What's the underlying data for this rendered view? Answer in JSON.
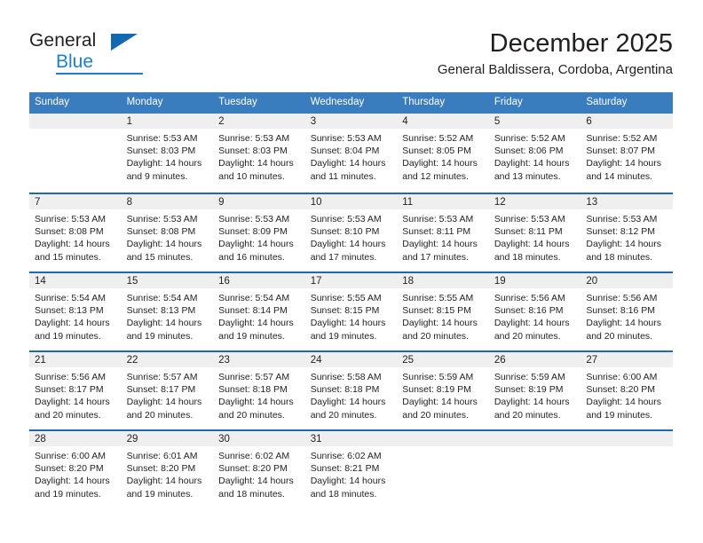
{
  "brand": {
    "name_top": "General",
    "name_bottom": "Blue",
    "accent_color": "#1b7fd4",
    "triangle_color": "#1268b3"
  },
  "header": {
    "title": "December 2025",
    "subtitle": "General Baldissera, Cordoba, Argentina"
  },
  "theme": {
    "header_blue": "#3a7dbf",
    "row_divider_blue": "#1f69b3",
    "daynum_bg": "#efefef",
    "text": "#231f20"
  },
  "weekday_headers": [
    "Sunday",
    "Monday",
    "Tuesday",
    "Wednesday",
    "Thursday",
    "Friday",
    "Saturday"
  ],
  "weeks": [
    [
      {
        "day": "",
        "empty": true,
        "sunrise": "",
        "sunset": "",
        "daylight_1": "",
        "daylight_2": ""
      },
      {
        "day": "1",
        "empty": false,
        "sunrise": "Sunrise: 5:53 AM",
        "sunset": "Sunset: 8:03 PM",
        "daylight_1": "Daylight: 14 hours",
        "daylight_2": "and 9 minutes."
      },
      {
        "day": "2",
        "empty": false,
        "sunrise": "Sunrise: 5:53 AM",
        "sunset": "Sunset: 8:03 PM",
        "daylight_1": "Daylight: 14 hours",
        "daylight_2": "and 10 minutes."
      },
      {
        "day": "3",
        "empty": false,
        "sunrise": "Sunrise: 5:53 AM",
        "sunset": "Sunset: 8:04 PM",
        "daylight_1": "Daylight: 14 hours",
        "daylight_2": "and 11 minutes."
      },
      {
        "day": "4",
        "empty": false,
        "sunrise": "Sunrise: 5:52 AM",
        "sunset": "Sunset: 8:05 PM",
        "daylight_1": "Daylight: 14 hours",
        "daylight_2": "and 12 minutes."
      },
      {
        "day": "5",
        "empty": false,
        "sunrise": "Sunrise: 5:52 AM",
        "sunset": "Sunset: 8:06 PM",
        "daylight_1": "Daylight: 14 hours",
        "daylight_2": "and 13 minutes."
      },
      {
        "day": "6",
        "empty": false,
        "sunrise": "Sunrise: 5:52 AM",
        "sunset": "Sunset: 8:07 PM",
        "daylight_1": "Daylight: 14 hours",
        "daylight_2": "and 14 minutes."
      }
    ],
    [
      {
        "day": "7",
        "empty": false,
        "sunrise": "Sunrise: 5:53 AM",
        "sunset": "Sunset: 8:08 PM",
        "daylight_1": "Daylight: 14 hours",
        "daylight_2": "and 15 minutes."
      },
      {
        "day": "8",
        "empty": false,
        "sunrise": "Sunrise: 5:53 AM",
        "sunset": "Sunset: 8:08 PM",
        "daylight_1": "Daylight: 14 hours",
        "daylight_2": "and 15 minutes."
      },
      {
        "day": "9",
        "empty": false,
        "sunrise": "Sunrise: 5:53 AM",
        "sunset": "Sunset: 8:09 PM",
        "daylight_1": "Daylight: 14 hours",
        "daylight_2": "and 16 minutes."
      },
      {
        "day": "10",
        "empty": false,
        "sunrise": "Sunrise: 5:53 AM",
        "sunset": "Sunset: 8:10 PM",
        "daylight_1": "Daylight: 14 hours",
        "daylight_2": "and 17 minutes."
      },
      {
        "day": "11",
        "empty": false,
        "sunrise": "Sunrise: 5:53 AM",
        "sunset": "Sunset: 8:11 PM",
        "daylight_1": "Daylight: 14 hours",
        "daylight_2": "and 17 minutes."
      },
      {
        "day": "12",
        "empty": false,
        "sunrise": "Sunrise: 5:53 AM",
        "sunset": "Sunset: 8:11 PM",
        "daylight_1": "Daylight: 14 hours",
        "daylight_2": "and 18 minutes."
      },
      {
        "day": "13",
        "empty": false,
        "sunrise": "Sunrise: 5:53 AM",
        "sunset": "Sunset: 8:12 PM",
        "daylight_1": "Daylight: 14 hours",
        "daylight_2": "and 18 minutes."
      }
    ],
    [
      {
        "day": "14",
        "empty": false,
        "sunrise": "Sunrise: 5:54 AM",
        "sunset": "Sunset: 8:13 PM",
        "daylight_1": "Daylight: 14 hours",
        "daylight_2": "and 19 minutes."
      },
      {
        "day": "15",
        "empty": false,
        "sunrise": "Sunrise: 5:54 AM",
        "sunset": "Sunset: 8:13 PM",
        "daylight_1": "Daylight: 14 hours",
        "daylight_2": "and 19 minutes."
      },
      {
        "day": "16",
        "empty": false,
        "sunrise": "Sunrise: 5:54 AM",
        "sunset": "Sunset: 8:14 PM",
        "daylight_1": "Daylight: 14 hours",
        "daylight_2": "and 19 minutes."
      },
      {
        "day": "17",
        "empty": false,
        "sunrise": "Sunrise: 5:55 AM",
        "sunset": "Sunset: 8:15 PM",
        "daylight_1": "Daylight: 14 hours",
        "daylight_2": "and 19 minutes."
      },
      {
        "day": "18",
        "empty": false,
        "sunrise": "Sunrise: 5:55 AM",
        "sunset": "Sunset: 8:15 PM",
        "daylight_1": "Daylight: 14 hours",
        "daylight_2": "and 20 minutes."
      },
      {
        "day": "19",
        "empty": false,
        "sunrise": "Sunrise: 5:56 AM",
        "sunset": "Sunset: 8:16 PM",
        "daylight_1": "Daylight: 14 hours",
        "daylight_2": "and 20 minutes."
      },
      {
        "day": "20",
        "empty": false,
        "sunrise": "Sunrise: 5:56 AM",
        "sunset": "Sunset: 8:16 PM",
        "daylight_1": "Daylight: 14 hours",
        "daylight_2": "and 20 minutes."
      }
    ],
    [
      {
        "day": "21",
        "empty": false,
        "sunrise": "Sunrise: 5:56 AM",
        "sunset": "Sunset: 8:17 PM",
        "daylight_1": "Daylight: 14 hours",
        "daylight_2": "and 20 minutes."
      },
      {
        "day": "22",
        "empty": false,
        "sunrise": "Sunrise: 5:57 AM",
        "sunset": "Sunset: 8:17 PM",
        "daylight_1": "Daylight: 14 hours",
        "daylight_2": "and 20 minutes."
      },
      {
        "day": "23",
        "empty": false,
        "sunrise": "Sunrise: 5:57 AM",
        "sunset": "Sunset: 8:18 PM",
        "daylight_1": "Daylight: 14 hours",
        "daylight_2": "and 20 minutes."
      },
      {
        "day": "24",
        "empty": false,
        "sunrise": "Sunrise: 5:58 AM",
        "sunset": "Sunset: 8:18 PM",
        "daylight_1": "Daylight: 14 hours",
        "daylight_2": "and 20 minutes."
      },
      {
        "day": "25",
        "empty": false,
        "sunrise": "Sunrise: 5:59 AM",
        "sunset": "Sunset: 8:19 PM",
        "daylight_1": "Daylight: 14 hours",
        "daylight_2": "and 20 minutes."
      },
      {
        "day": "26",
        "empty": false,
        "sunrise": "Sunrise: 5:59 AM",
        "sunset": "Sunset: 8:19 PM",
        "daylight_1": "Daylight: 14 hours",
        "daylight_2": "and 20 minutes."
      },
      {
        "day": "27",
        "empty": false,
        "sunrise": "Sunrise: 6:00 AM",
        "sunset": "Sunset: 8:20 PM",
        "daylight_1": "Daylight: 14 hours",
        "daylight_2": "and 19 minutes."
      }
    ],
    [
      {
        "day": "28",
        "empty": false,
        "sunrise": "Sunrise: 6:00 AM",
        "sunset": "Sunset: 8:20 PM",
        "daylight_1": "Daylight: 14 hours",
        "daylight_2": "and 19 minutes."
      },
      {
        "day": "29",
        "empty": false,
        "sunrise": "Sunrise: 6:01 AM",
        "sunset": "Sunset: 8:20 PM",
        "daylight_1": "Daylight: 14 hours",
        "daylight_2": "and 19 minutes."
      },
      {
        "day": "30",
        "empty": false,
        "sunrise": "Sunrise: 6:02 AM",
        "sunset": "Sunset: 8:20 PM",
        "daylight_1": "Daylight: 14 hours",
        "daylight_2": "and 18 minutes."
      },
      {
        "day": "31",
        "empty": false,
        "sunrise": "Sunrise: 6:02 AM",
        "sunset": "Sunset: 8:21 PM",
        "daylight_1": "Daylight: 14 hours",
        "daylight_2": "and 18 minutes."
      },
      {
        "day": "",
        "empty": true,
        "sunrise": "",
        "sunset": "",
        "daylight_1": "",
        "daylight_2": ""
      },
      {
        "day": "",
        "empty": true,
        "sunrise": "",
        "sunset": "",
        "daylight_1": "",
        "daylight_2": ""
      },
      {
        "day": "",
        "empty": true,
        "sunrise": "",
        "sunset": "",
        "daylight_1": "",
        "daylight_2": ""
      }
    ]
  ]
}
